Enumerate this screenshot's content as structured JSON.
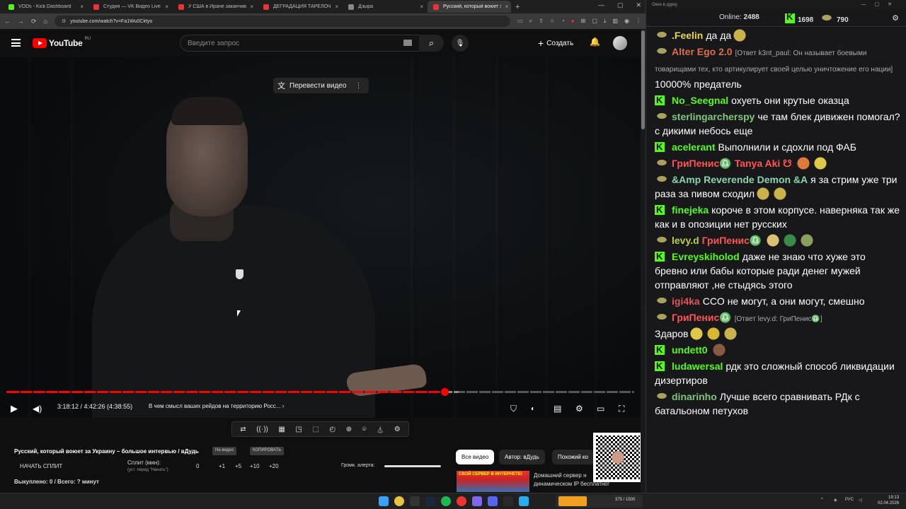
{
  "browser": {
    "tabs": [
      {
        "label": "VODs - Kick Dashboard",
        "color": "#53fc18"
      },
      {
        "label": "Студия — VK Видео Live",
        "color": "#e33"
      },
      {
        "label": "У США в Иране заканчиваются",
        "color": "#e33"
      },
      {
        "label": "ДЕГРАДАЦИЯ ТАРЕЛОЧНИЦ",
        "color": "#e33"
      },
      {
        "label": "Дзыра",
        "color": "#888"
      },
      {
        "label": "Русский, который воюет за",
        "color": "#e33",
        "active": true
      }
    ],
    "url": "youtube.com/watch?v=Fa1Wu0Cktyo"
  },
  "youtube": {
    "logo_text": "YouTube",
    "logo_region": "RU",
    "search_placeholder": "Введите запрос",
    "create_label": "Создать"
  },
  "player": {
    "translate_label": "Перевести видео",
    "time_text": "3:18:12 / 4:42:26 (4:38:55)",
    "chapter_text": "В чем смысл ваших рейдов на территорию Росс...",
    "progress_fraction": 0.698,
    "buffered_fraction": 0.72
  },
  "under": {
    "title": "Русский, который воюет за Украину – большое интервью / вДудь",
    "pill_video": "На видео",
    "pill_copy": "КОПИРОВАТЬ",
    "start_split": "НАЧАТЬ СПЛИТ",
    "split_label": "Сплит (мин):",
    "split_hint": "(уст. перед \"Начать\")",
    "split_values": [
      "0",
      "+1",
      "+5",
      "+10",
      "+20"
    ],
    "alert_label": "Громк. алерта:",
    "bought": "Выкуплено: 0 / Всего: ? минут",
    "chips": [
      "Все видео",
      "Автор: вДудь",
      "Похожий ко"
    ],
    "ad_banner": "СВОЙ СЕРВЕР В ИНТЕРНЕТЕ!",
    "ad_text1": "Домашний сервер н",
    "ad_text2": "динамическом IP бесплатно!"
  },
  "chat": {
    "window_title": "Окно в дурку",
    "online_label": "Online:",
    "online_count": "2488",
    "kick_count": "1698",
    "other_count": "790",
    "messages": [
      {
        "user": ".Feelin",
        "color": "#e7d54a",
        "platform": "y",
        "reply": "",
        "text": "да да",
        "emotes": [
          "e1"
        ]
      },
      {
        "user": "Alter Ego 2.0",
        "color": "#d8704a",
        "platform": "y",
        "reply": "[Ответ k3nt_paul: Он называет боевыми товарищами тех, кто артикулирует своей целью уничтожение его нации]",
        "text": "10000% предатель",
        "emotes": []
      },
      {
        "user": "No_Seegnal",
        "color": "#53fc18",
        "platform": "k",
        "reply": "",
        "text": "охуеть они крутые оказца",
        "emotes": []
      },
      {
        "user": "sterlingarchersру",
        "color": "#7ec87e",
        "platform": "y",
        "reply": "",
        "text": "че там блек дивижен помогал? с дикими небось еще",
        "emotes": []
      },
      {
        "user": "acelerant",
        "color": "#53fc18",
        "platform": "k",
        "reply": "",
        "text": "Выполнили и сдохли под ФАБ",
        "emotes": []
      },
      {
        "user": "ГриПенис♎",
        "color": "#f55",
        "platform": "y",
        "reply": "",
        "text": "",
        "mention": "Tanya Aki ☋",
        "emotes": [
          "e2",
          "e3"
        ]
      },
      {
        "user": "&Amp Reverende Demon &A",
        "color": "#8ad4b0",
        "platform": "y",
        "reply": "",
        "text": "я за стрим уже три раза за пивом сходил",
        "emotes": [
          "e1",
          "e1"
        ]
      },
      {
        "user": "finejeka",
        "color": "#53fc18",
        "platform": "k",
        "reply": "",
        "text": "короче в этом корпусе. наверняка так же как и в опозиции нет русских",
        "emotes": []
      },
      {
        "user": "levy.d",
        "color": "#b4d44a",
        "platform": "y",
        "reply": "",
        "text": "",
        "mention": "ГриПенис♎",
        "emotes": [
          "e4",
          "e5",
          "e6"
        ]
      },
      {
        "user": "Evreyskiholod",
        "color": "#53fc18",
        "platform": "k",
        "reply": "",
        "text": "даже не знаю что хуже это бревно или бабы которые ради денег мужей отправляют ,не стыдясь этого",
        "emotes": []
      },
      {
        "user": "igi4ka",
        "color": "#e05555",
        "platform": "y",
        "reply": "",
        "text": "СCO не могут, а они могут, смешно",
        "emotes": []
      },
      {
        "user": "ГриПенис♎",
        "color": "#f55",
        "platform": "y",
        "reply": "[Ответ levy.d: ГриПенис♎]",
        "text": "Здаров",
        "emotes": [
          "e3",
          "e7",
          "e1"
        ]
      },
      {
        "user": "undett0",
        "color": "#53fc18",
        "platform": "k",
        "reply": "",
        "text": "",
        "emotes": [
          "e8"
        ]
      },
      {
        "user": "ludawersal",
        "color": "#53fc18",
        "platform": "k",
        "reply": "",
        "text": "рдк это сложный способ ликвидации дизертиров",
        "emotes": []
      },
      {
        "user": "dinarinho",
        "color": "#7ec87e",
        "platform": "y",
        "reply": "",
        "text": "Лучше всего сравнивать РДк с батальоном петухов",
        "emotes": []
      }
    ]
  },
  "taskbar": {
    "lang": "РУС",
    "time": "19:13",
    "date": "02.04.2026",
    "stream_counter": "375 / 1500"
  }
}
